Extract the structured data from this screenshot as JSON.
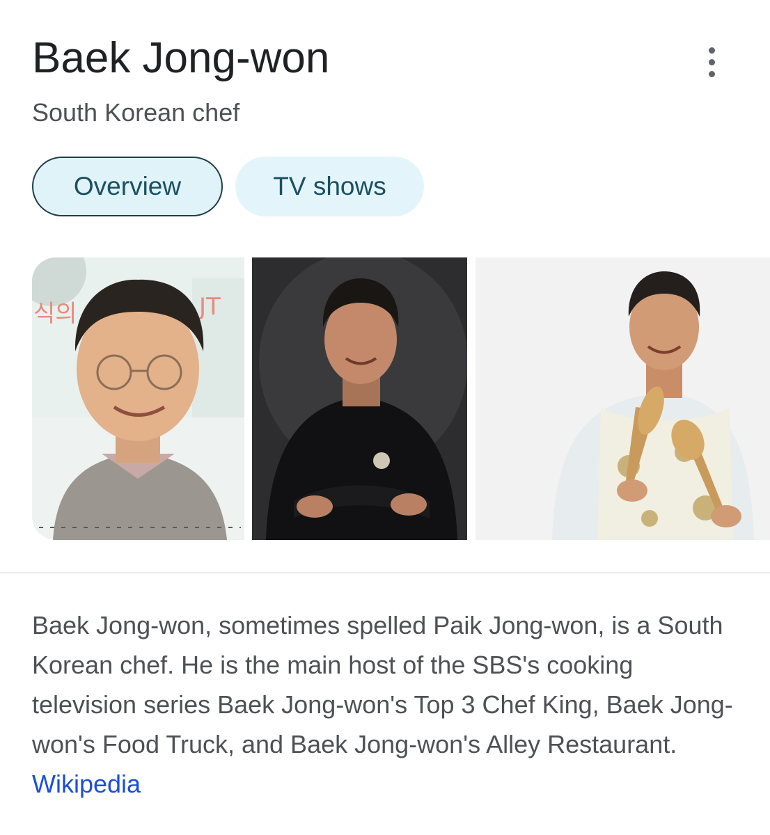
{
  "header": {
    "title": "Baek Jong-won",
    "subtitle": "South Korean chef",
    "more_icon": "more-vert-icon"
  },
  "tabs": [
    {
      "label": "Overview",
      "selected": true
    },
    {
      "label": "TV shows",
      "selected": false
    }
  ],
  "images": {
    "photo1_sign_text": "식의",
    "photo1_logo_text": "JT"
  },
  "description": {
    "text": "Baek Jong-won, sometimes spelled Paik Jong-won, is a South Korean chef. He is the main host of the SBS's cooking television series Baek Jong-won's Top 3 Chef King, Baek Jong-won's Food Truck, and Baek Jong-won's Alley Restaurant.",
    "source_link": "Wikipedia"
  },
  "colors": {
    "chip_active_bg": "#dff3f8",
    "chip_border": "#1f3e47",
    "chip_text": "#1b4f63",
    "link": "#1a4fd6"
  }
}
